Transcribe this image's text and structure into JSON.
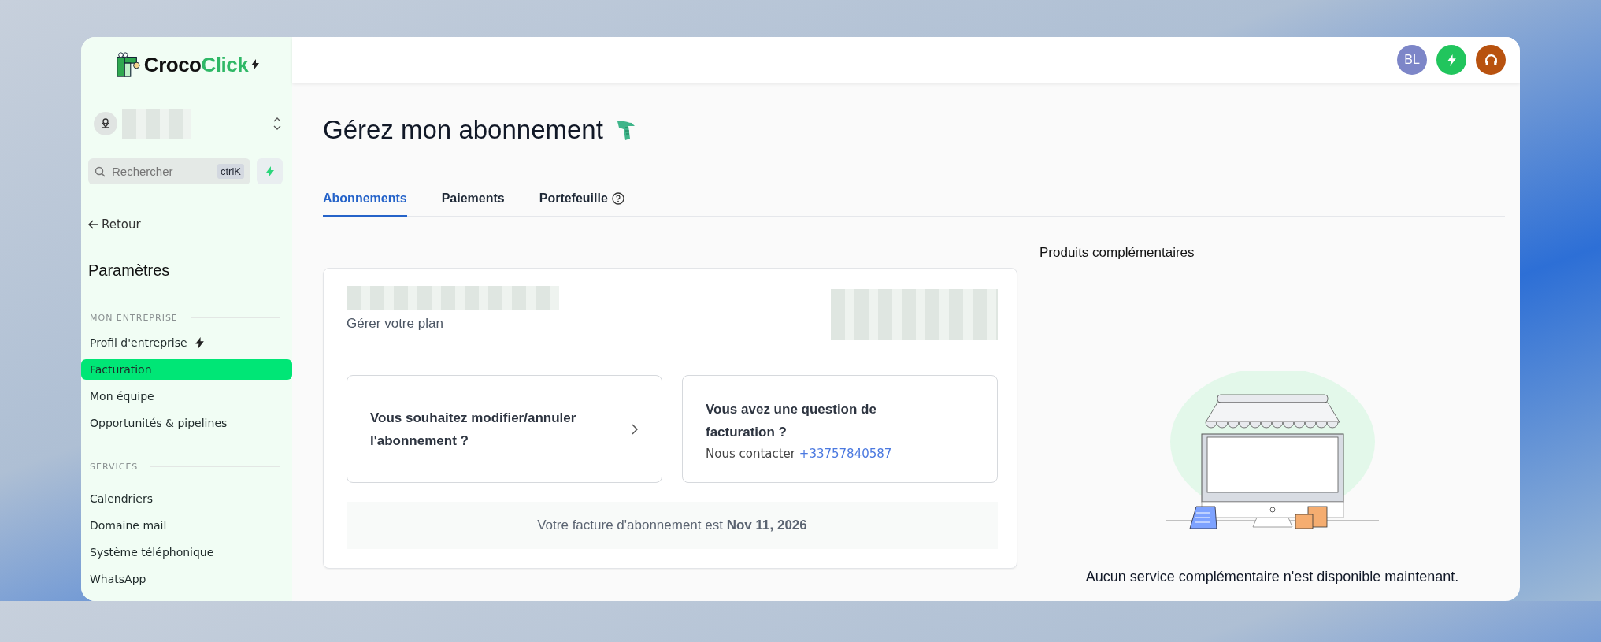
{
  "logo": {
    "word_dark": "Croco",
    "word_green": "Click"
  },
  "search": {
    "placeholder": "Rechercher",
    "shortcut": "ctrlK"
  },
  "back_link": "Retour",
  "sidebar": {
    "title": "Paramètres",
    "sections": [
      {
        "heading": "MON ENTREPRISE",
        "items": [
          {
            "label": "Profil d'entreprise",
            "selected": false,
            "kind": "bolt"
          },
          {
            "label": "Facturation",
            "selected": true,
            "kind": "plain"
          },
          {
            "label": "Mon équipe",
            "selected": false,
            "kind": "plain"
          },
          {
            "label": "Opportunités & pipelines",
            "selected": false,
            "kind": "plain"
          }
        ]
      },
      {
        "heading": "SERVICES",
        "items": [
          {
            "label": "Calendriers",
            "selected": false,
            "kind": "plain"
          },
          {
            "label": "Domaine mail",
            "selected": false,
            "kind": "plain"
          },
          {
            "label": "Système téléphonique",
            "selected": false,
            "kind": "plain"
          },
          {
            "label": "WhatsApp",
            "selected": false,
            "kind": "plain"
          }
        ]
      }
    ]
  },
  "header": {
    "avatar": "BL"
  },
  "page_title": "Gérez mon abonnement",
  "tabs": [
    {
      "label": "Abonnements",
      "selected": true,
      "kind": "plain"
    },
    {
      "label": "Paiements",
      "selected": false,
      "kind": "plain"
    },
    {
      "label": "Portefeuille",
      "selected": false,
      "kind": "help"
    }
  ],
  "subscription": {
    "subtitle": "Gérer votre plan",
    "actions": [
      {
        "kind": "link",
        "title": "Vous souhaitez modifier/annuler l'abonnement ?"
      },
      {
        "kind": "contact",
        "title": "Vous avez une question de facturation ?",
        "contact_label": "Nous contacter",
        "phone": "+33757840587"
      }
    ],
    "invoice_note": "Votre facture d'abonnement est **Nov 11, 2026**"
  },
  "addons": {
    "title": "Produits complémentaires",
    "empty_message": "Aucun service complémentaire n'est disponible maintenant."
  }
}
